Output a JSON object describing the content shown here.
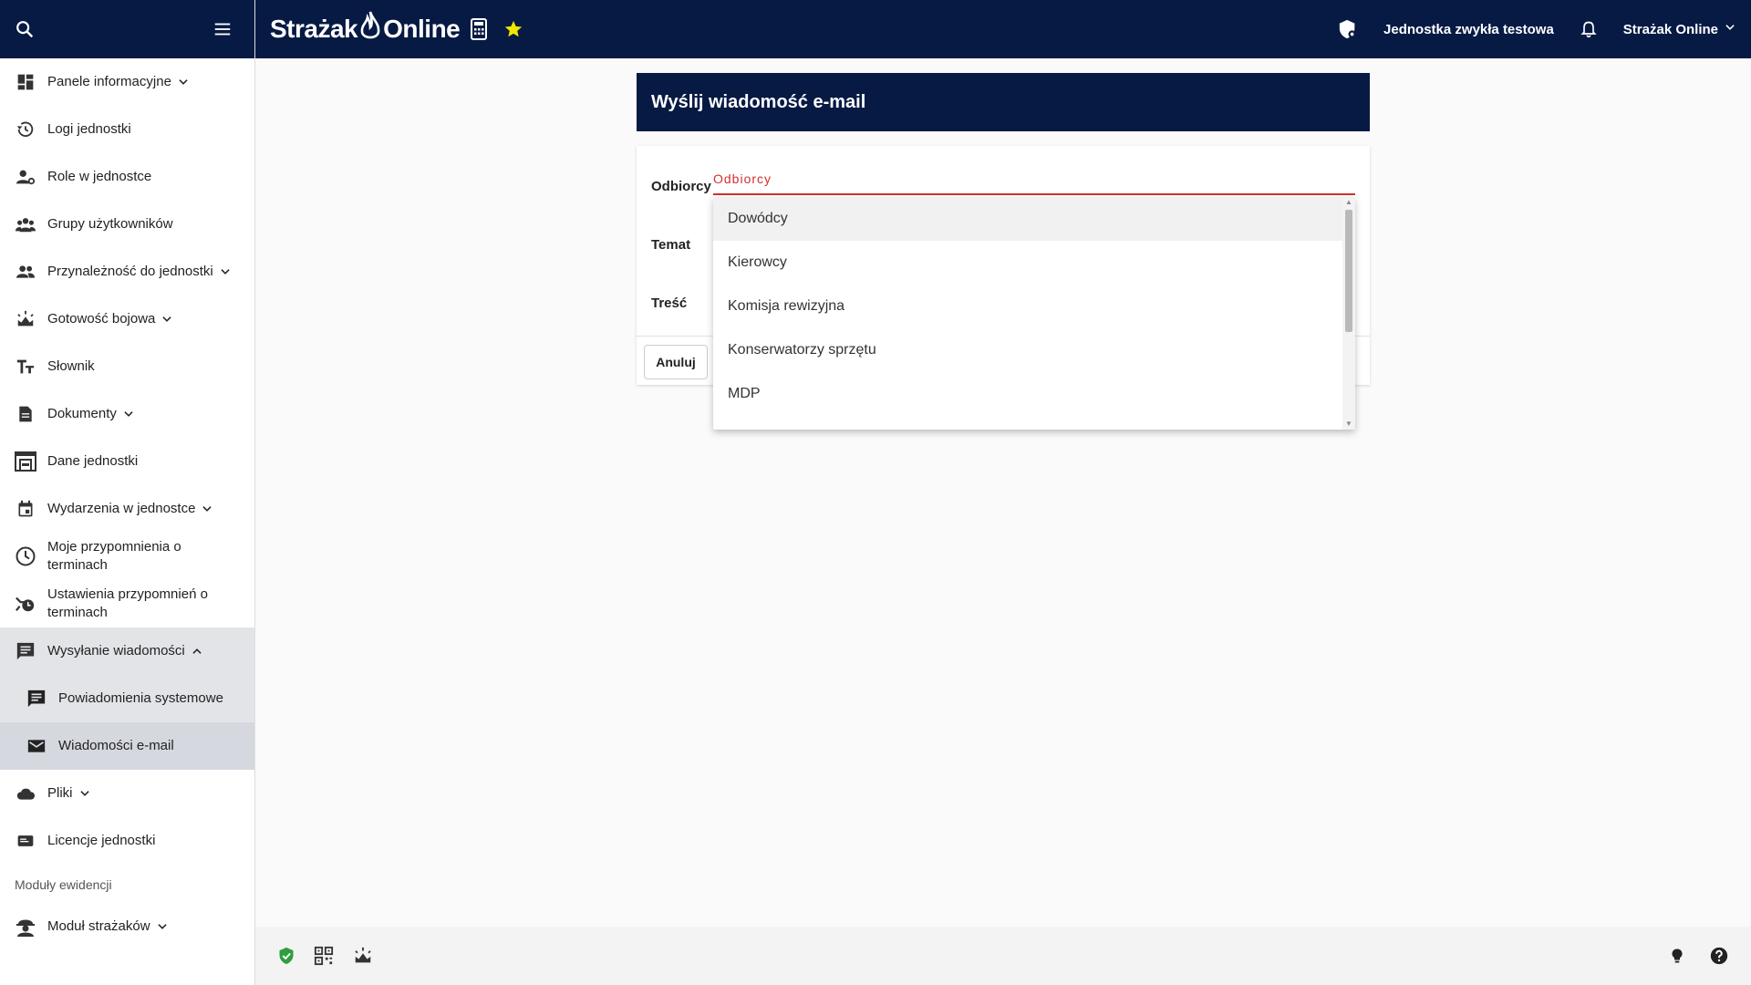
{
  "header": {
    "brand_part1": "Strażak",
    "brand_part2": "Online",
    "unit_name": "Jednostka zwykła testowa",
    "account_label": "Strażak Online"
  },
  "sidebar": {
    "items": [
      {
        "label": "Panele informacyjne",
        "icon": "dashboard-icon",
        "expandable": true
      },
      {
        "label": "Logi jednostki",
        "icon": "history-icon"
      },
      {
        "label": "Role w jednostce",
        "icon": "user-roles-icon"
      },
      {
        "label": "Grupy użytkowników",
        "icon": "groups-icon"
      },
      {
        "label": "Przynależność do jednostki",
        "icon": "people-icon",
        "expandable": true
      },
      {
        "label": "Gotowość bojowa",
        "icon": "siren-icon",
        "expandable": true
      },
      {
        "label": "Słownik",
        "icon": "text-size-icon"
      },
      {
        "label": "Dokumenty",
        "icon": "document-icon",
        "expandable": true
      },
      {
        "label": "Dane jednostki",
        "icon": "firestation-icon"
      },
      {
        "label": "Wydarzenia w jednostce",
        "icon": "calendar-icon",
        "expandable": true
      },
      {
        "label": "Moje przypomnienia o terminach",
        "icon": "clock-icon"
      },
      {
        "label": "Ustawienia przypomnień o terminach",
        "icon": "alarm-settings-icon"
      },
      {
        "label": "Wysyłanie wiadomości",
        "icon": "chat-icon",
        "expandable": true,
        "expanded": true
      },
      {
        "label": "Powiadomienia systemowe",
        "icon": "chat-icon",
        "sub": true
      },
      {
        "label": "Wiadomości e-mail",
        "icon": "mail-icon",
        "sub": true,
        "active": true
      },
      {
        "label": "Pliki",
        "icon": "cloud-icon",
        "expandable": true
      },
      {
        "label": "Licencje jednostki",
        "icon": "license-icon"
      }
    ],
    "section_label": "Moduły ewidencji",
    "module_item": {
      "label": "Moduł strażaków",
      "icon": "firefighter-icon",
      "expandable": true
    }
  },
  "form": {
    "title": "Wyślij wiadomość e-mail",
    "recipients_label": "Odbiorcy",
    "recipients_placeholder": "Odbiorcy",
    "subject_label": "Temat",
    "content_label": "Treść",
    "cancel_label": "Anuluj"
  },
  "dropdown": {
    "options": [
      "Dowódcy",
      "Kierowcy",
      "Komisja rewizyjna",
      "Konserwatorzy sprzętu",
      "MDP"
    ],
    "highlighted_index": 0
  },
  "colors": {
    "navy": "#071a44",
    "error": "#d32f2f",
    "star": "#f2e600",
    "shield_green": "#2e9e3e"
  }
}
